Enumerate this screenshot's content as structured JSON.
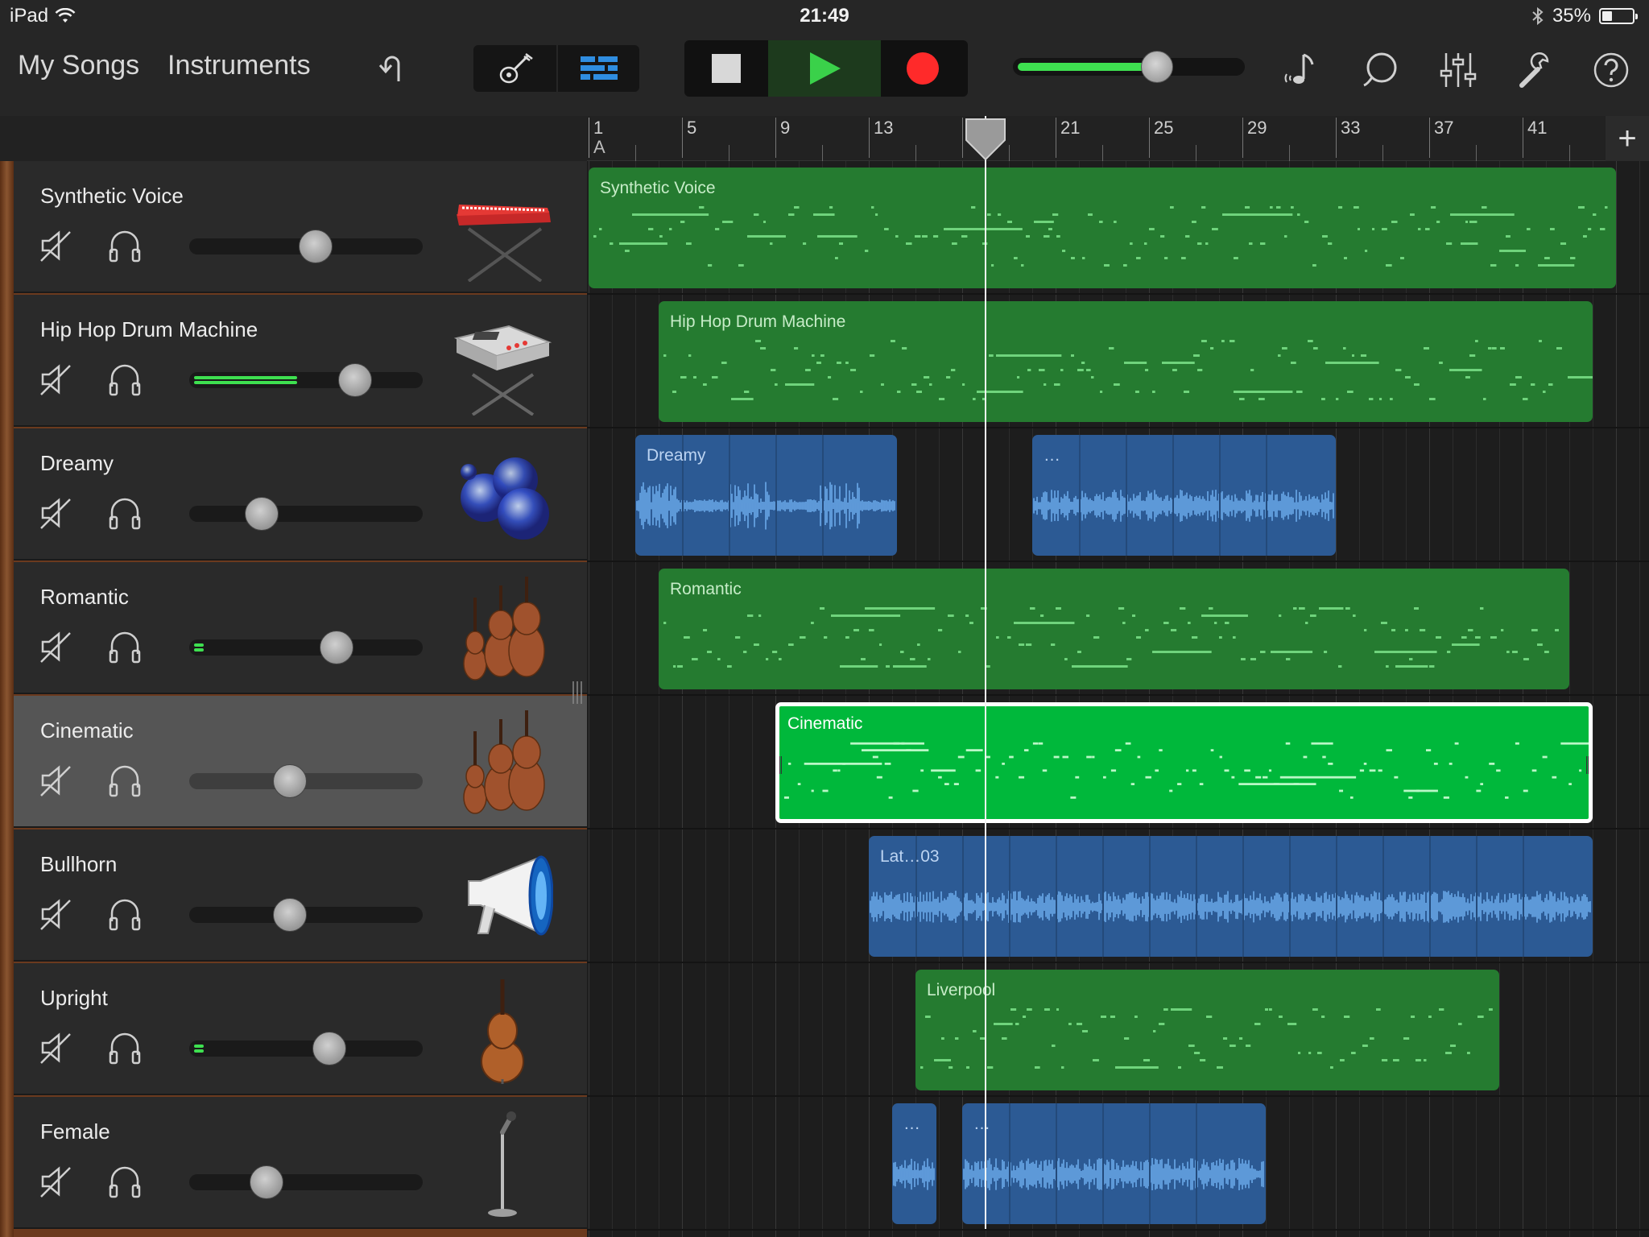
{
  "status_bar": {
    "device": "iPad",
    "time": "21:49",
    "battery": "35%"
  },
  "toolbar": {
    "my_songs": "My Songs",
    "instruments": "Instruments",
    "master_volume": 0.62
  },
  "ruler": {
    "bars": [
      "1",
      "5",
      "9",
      "13",
      "17",
      "21",
      "25",
      "29",
      "33",
      "37",
      "41"
    ],
    "marker": "A",
    "playhead_bar": 18
  },
  "tracks": [
    {
      "name": "Synthetic Voice",
      "volume": 0.54,
      "meter": 0,
      "instrument": "keyboard-synth"
    },
    {
      "name": "Hip Hop Drum Machine",
      "volume": 0.71,
      "meter": 0.44,
      "instrument": "drum-machine"
    },
    {
      "name": "Dreamy",
      "volume": 0.31,
      "meter": 0,
      "instrument": "bubbles"
    },
    {
      "name": "Romantic",
      "volume": 0.63,
      "meter": 0.04,
      "instrument": "strings-ensemble"
    },
    {
      "name": "Cinematic",
      "volume": 0.43,
      "meter": 0,
      "instrument": "strings-ensemble",
      "selected": true
    },
    {
      "name": "Bullhorn",
      "volume": 0.43,
      "meter": 0,
      "instrument": "megaphone"
    },
    {
      "name": "Upright",
      "volume": 0.6,
      "meter": 0.04,
      "instrument": "upright-bass"
    },
    {
      "name": "Female",
      "volume": 0.33,
      "meter": 0,
      "instrument": "microphone"
    }
  ],
  "regions": [
    {
      "track": 0,
      "type": "midi",
      "label": "Synthetic Voice",
      "start": 1,
      "end": 45
    },
    {
      "track": 1,
      "type": "midi",
      "label": "Hip Hop Drum Machine",
      "start": 4,
      "end": 44
    },
    {
      "track": 2,
      "type": "audio",
      "label": "Dreamy",
      "start": 3,
      "end": 14.2
    },
    {
      "track": 2,
      "type": "audio",
      "label": "…",
      "start": 20,
      "end": 33
    },
    {
      "track": 3,
      "type": "midi",
      "label": "Romantic",
      "start": 4,
      "end": 43
    },
    {
      "track": 4,
      "type": "midi-selected",
      "label": "Cinematic",
      "start": 9,
      "end": 44
    },
    {
      "track": 5,
      "type": "audio",
      "label": "Lat…03",
      "start": 13,
      "end": 44
    },
    {
      "track": 6,
      "type": "midi",
      "label": "Liverpool",
      "start": 15,
      "end": 40
    },
    {
      "track": 7,
      "type": "audio",
      "label": "…",
      "start": 14,
      "end": 15.9
    },
    {
      "track": 7,
      "type": "audio",
      "label": "…",
      "start": 17,
      "end": 30
    }
  ],
  "colors": {
    "midi": "#257b30",
    "audio": "#2c5a94",
    "selected_midi": "#00b83b",
    "meter": "#3ee050",
    "record": "#ff2a2a",
    "play": "#3ad14a"
  }
}
